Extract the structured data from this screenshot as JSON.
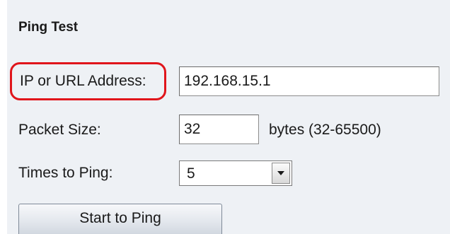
{
  "form": {
    "title": "Ping Test",
    "ip_label": "IP or URL Address:",
    "ip_value": "192.168.15.1",
    "packet_label": "Packet Size:",
    "packet_value": "32",
    "packet_hint": "bytes (32-65500)",
    "times_label": "Times to Ping:",
    "times_value": "5",
    "start_button": "Start to Ping"
  },
  "colors": {
    "panel_background": "#eef1f5",
    "highlight_outline": "#e0151b"
  }
}
